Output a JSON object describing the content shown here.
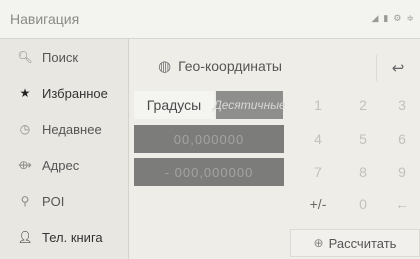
{
  "window": {
    "title": "Навигация"
  },
  "status": {
    "icons": [
      "signal-icon",
      "bluetooth-icon",
      "settings-icon",
      "wifi-icon"
    ]
  },
  "sidebar": {
    "items": [
      {
        "label": "Поиск",
        "icon": "search-icon"
      },
      {
        "label": "Избранное",
        "icon": "star-icon"
      },
      {
        "label": "Недавнее",
        "icon": "recent-icon"
      },
      {
        "label": "Адрес",
        "icon": "address-icon"
      },
      {
        "label": "POI",
        "icon": "poi-icon"
      },
      {
        "label": "Тел. книга",
        "icon": "contacts-icon"
      }
    ]
  },
  "main": {
    "title": "Гео-координаты",
    "format": {
      "degrees": "Градусы",
      "decimal": "Десятичные"
    },
    "latitude": "00,000000",
    "longitude": "- 000,000000",
    "keypad": [
      "1",
      "2",
      "3",
      "4",
      "5",
      "6",
      "7",
      "8",
      "9",
      "+/-",
      "0",
      "←"
    ],
    "calculate": "Рассчитать"
  }
}
